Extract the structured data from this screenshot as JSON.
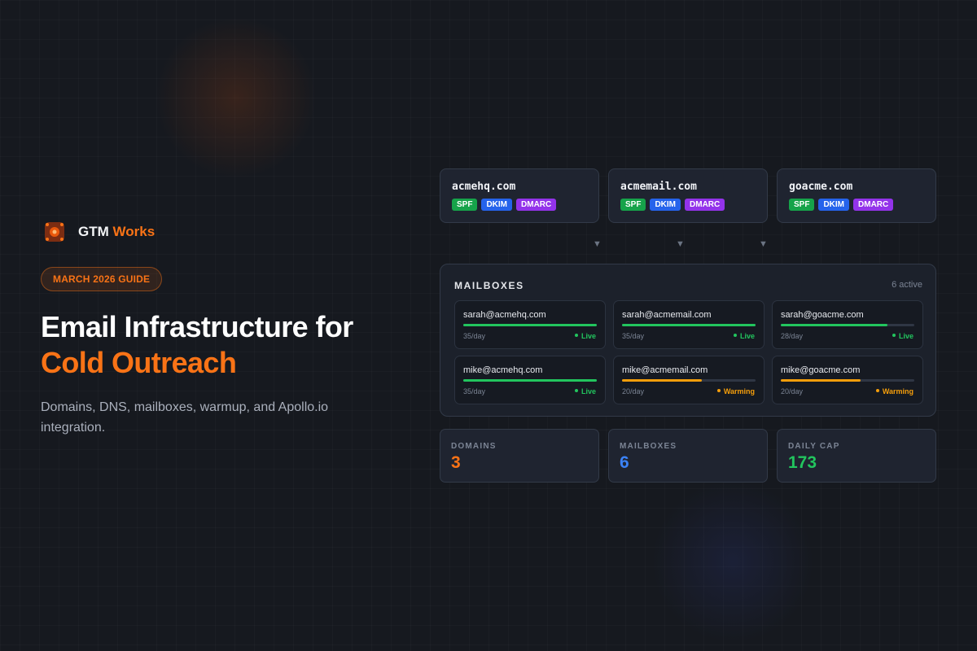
{
  "brand": {
    "name": "GTM",
    "accent": "Works"
  },
  "guide_badge": "MARCH 2026 GUIDE",
  "headline": {
    "line1": "Email Infrastructure for",
    "line2": "Cold Outreach"
  },
  "subtitle": "Domains, DNS, mailboxes, warmup, and Apollo.io integration.",
  "domains": [
    {
      "name": "acmehq.com",
      "tags": [
        "SPF",
        "DKIM",
        "DMARC"
      ]
    },
    {
      "name": "acmemail.com",
      "tags": [
        "SPF",
        "DKIM",
        "DMARC"
      ]
    },
    {
      "name": "goacme.com",
      "tags": [
        "SPF",
        "DKIM",
        "DMARC"
      ]
    }
  ],
  "arrow_glyph": "▼",
  "mailboxes": {
    "title": "MAILBOXES",
    "count": "6 active",
    "items": [
      {
        "email": "sarah@acmehq.com",
        "rate": "35/day",
        "status": "Live",
        "progress": 1.0
      },
      {
        "email": "sarah@acmemail.com",
        "rate": "35/day",
        "status": "Live",
        "progress": 1.0
      },
      {
        "email": "sarah@goacme.com",
        "rate": "28/day",
        "status": "Live",
        "progress": 0.8
      },
      {
        "email": "mike@acmehq.com",
        "rate": "35/day",
        "status": "Live",
        "progress": 1.0
      },
      {
        "email": "mike@acmemail.com",
        "rate": "20/day",
        "status": "Warming",
        "progress": 0.6
      },
      {
        "email": "mike@goacme.com",
        "rate": "20/day",
        "status": "Warming",
        "progress": 0.6
      }
    ]
  },
  "stats": [
    {
      "label": "DOMAINS",
      "value": "3",
      "color": "#f97316"
    },
    {
      "label": "MAILBOXES",
      "value": "6",
      "color": "#3b82f6"
    },
    {
      "label": "DAILY CAP",
      "value": "173",
      "color": "#22c55e"
    }
  ],
  "colors": {
    "accent": "#f97316",
    "live": "#22c55e",
    "warming": "#f59e0b",
    "spf": "#16a34a",
    "dkim": "#2563eb",
    "dmarc": "#9333ea"
  }
}
